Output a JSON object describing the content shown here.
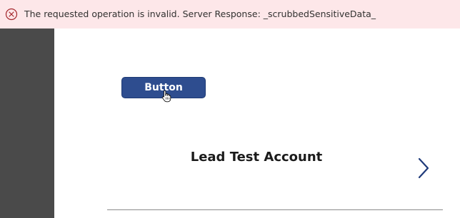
{
  "error_banner": {
    "message": "The requested operation is invalid. Server Response: _scrubbedSensitiveData_",
    "icon": "error-circle-x-icon",
    "background_color": "#fde7e9",
    "icon_color": "#a4262c"
  },
  "canvas": {
    "button_label": "Button",
    "button_color": "#2e4d8f",
    "record_title": "Lead Test Account",
    "next_icon": "chevron-right-icon",
    "chevron_color": "#1f3a7a",
    "side_panel_color": "#4a4a4a"
  }
}
